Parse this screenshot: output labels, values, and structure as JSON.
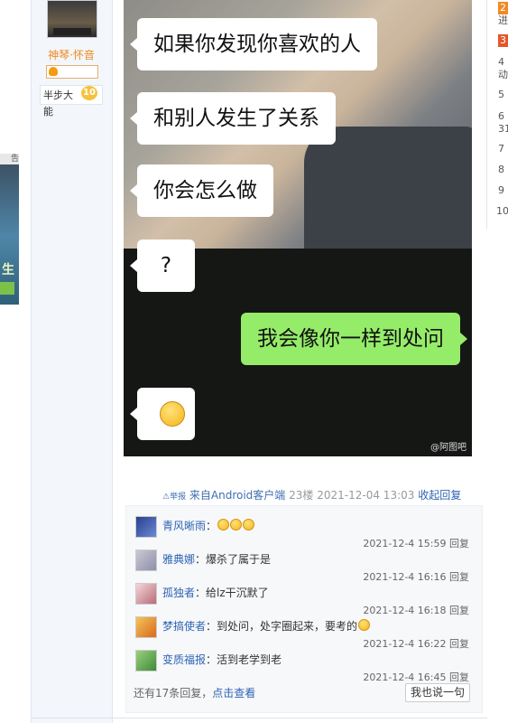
{
  "author": {
    "username": "神琴·怀音",
    "level_name": "半步大能",
    "level_number": "10"
  },
  "post_image": {
    "bubbles": [
      "如果你发现你喜欢的人",
      "和别人发生了关系",
      "你会怎么做",
      "?",
      "我会像你一样到处问"
    ],
    "watermark": "@阿图吧"
  },
  "post_meta": {
    "report": "⚠举报",
    "source": "来自Android客户端",
    "floor": "23楼",
    "time": "2021-12-04 13:03",
    "reply_toggle": "收起回复"
  },
  "replies": [
    {
      "user": "青风晰雨",
      "text": "：",
      "emoji_count": 3,
      "time": "2021-12-4 15:59",
      "reply_label": "回复"
    },
    {
      "user": "雅典娜",
      "text": "：爆杀了属于是",
      "time": "2021-12-4 16:16",
      "reply_label": "回复"
    },
    {
      "user": "孤独者",
      "text": "：给lz干沉默了",
      "time": "2021-12-4 16:18",
      "reply_label": "回复"
    },
    {
      "user": "梦搞使者",
      "text": "：到处问，处字圈起来，要考的",
      "emoji_count": 1,
      "time": "2021-12-4 16:22",
      "reply_label": "回复"
    },
    {
      "user": "变质福报",
      "text": "：活到老学到老",
      "time": "2021-12-4 16:45",
      "reply_label": "回复"
    }
  ],
  "more_replies": {
    "text": "还有17条回复，",
    "link": "点击查看"
  },
  "reply_button": "我也说一句",
  "sidebar_ranks": [
    {
      "num": "2",
      "text": "进"
    },
    {
      "num": "3",
      "text": ""
    },
    {
      "num": "4",
      "text": "动"
    },
    {
      "num": "5",
      "text": ""
    },
    {
      "num": "6",
      "text": "31"
    },
    {
      "num": "7",
      "text": ""
    },
    {
      "num": "8",
      "text": ""
    },
    {
      "num": "9",
      "text": ""
    },
    {
      "num": "10",
      "text": ""
    }
  ],
  "left_ad": {
    "tag": "告",
    "char": "生"
  },
  "colors": {
    "accent": "#2d64b3",
    "username": "#f08a24",
    "wechat_green": "#95ec69"
  }
}
